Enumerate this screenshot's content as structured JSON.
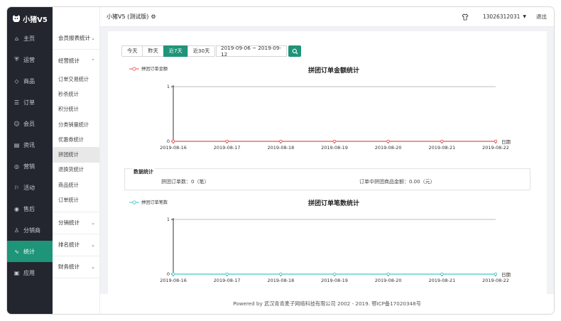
{
  "app": {
    "logo_text": "小猪V5",
    "brand_title": "小猪V5 (测试版)",
    "phone": "13026312031",
    "logout": "退出",
    "colors": {
      "accent": "#1e9479",
      "sidebar_bg": "#23262e",
      "line_red": "#e05555",
      "line_cyan": "#43c6c6"
    }
  },
  "sidebar": {
    "items": [
      {
        "label": "主页",
        "icon": "home-icon"
      },
      {
        "label": "运营",
        "icon": "shield-icon"
      },
      {
        "label": "商品",
        "icon": "tag-icon"
      },
      {
        "label": "订单",
        "icon": "list-icon"
      },
      {
        "label": "会员",
        "icon": "user-icon"
      },
      {
        "label": "资讯",
        "icon": "news-icon"
      },
      {
        "label": "营销",
        "icon": "coin-icon"
      },
      {
        "label": "活动",
        "icon": "flag-icon"
      },
      {
        "label": "售后",
        "icon": "service-icon"
      },
      {
        "label": "分销商",
        "icon": "person-icon"
      },
      {
        "label": "统计",
        "icon": "pulse-icon",
        "active": true
      },
      {
        "label": "应用",
        "icon": "app-icon"
      }
    ]
  },
  "submenu": {
    "group_member_report": "会员报表统计",
    "group_business": "经营统计",
    "items": [
      {
        "label": "订单交易统计"
      },
      {
        "label": "秒杀统计"
      },
      {
        "label": "积分统计"
      },
      {
        "label": "分类销量统计"
      },
      {
        "label": "优惠券统计"
      },
      {
        "label": "拼团统计",
        "active": true
      },
      {
        "label": "退换货统计"
      },
      {
        "label": "商品统计"
      },
      {
        "label": "订单统计"
      }
    ],
    "group_distribution": "分销统计",
    "group_ranking": "排名统计",
    "group_finance": "财务统计"
  },
  "toolbar": {
    "ranges": [
      "今天",
      "昨天",
      "近7天",
      "近30天"
    ],
    "active_range": "近7天",
    "date_range": "2019-09-06 ~ 2019-09-12"
  },
  "summary": {
    "title": "数据统计",
    "group_orders": "拼团订单数：0（笔）",
    "group_amount": "订单中拼团商品金额：0.00（元）"
  },
  "chart_data": [
    {
      "type": "line",
      "title": "拼团订单金额统计",
      "legend": [
        "拼团订单金额"
      ],
      "xlabel": "日期",
      "x": [
        "2019-08-16",
        "2019-08-17",
        "2019-08-18",
        "2019-08-19",
        "2019-08-20",
        "2019-08-21",
        "2019-08-22"
      ],
      "series": [
        {
          "name": "拼团订单金额",
          "values": [
            0,
            0,
            0,
            0,
            0,
            0,
            0
          ],
          "color": "#e05555"
        }
      ],
      "ylim": [
        0,
        1
      ],
      "yticks": [
        "0",
        "1"
      ],
      "grid": true
    },
    {
      "type": "line",
      "title": "拼团订单笔数统计",
      "legend": [
        "拼团订单笔数"
      ],
      "xlabel": "日期",
      "x": [
        "2019-08-16",
        "2019-08-17",
        "2019-08-18",
        "2019-08-19",
        "2019-08-20",
        "2019-08-21",
        "2019-08-22"
      ],
      "series": [
        {
          "name": "拼团订单笔数",
          "values": [
            0,
            0,
            0,
            0,
            0,
            0,
            0
          ],
          "color": "#43c6c6"
        }
      ],
      "ylim": [
        0,
        1
      ],
      "yticks": [
        "0",
        "1"
      ],
      "grid": true
    }
  ],
  "footer": {
    "text": "Powered by 武汉青青麦子网络科技有限公司 2002 - 2019. 鄂ICP备17020348号"
  }
}
